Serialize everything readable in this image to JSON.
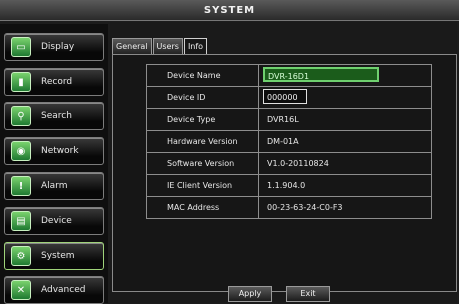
{
  "window": {
    "title": "SYSTEM"
  },
  "sidebar": {
    "items": [
      {
        "label": "Display",
        "icon": "display-icon",
        "active": false
      },
      {
        "label": "Record",
        "icon": "record-icon",
        "active": false
      },
      {
        "label": "Search",
        "icon": "search-icon",
        "active": false
      },
      {
        "label": "Network",
        "icon": "network-icon",
        "active": false
      },
      {
        "label": "Alarm",
        "icon": "alarm-icon",
        "active": false
      },
      {
        "label": "Device",
        "icon": "device-icon",
        "active": false
      },
      {
        "label": "System",
        "icon": "system-icon",
        "active": true
      },
      {
        "label": "Advanced",
        "icon": "advanced-icon",
        "active": false
      }
    ]
  },
  "tabs": [
    {
      "label": "General",
      "active": false
    },
    {
      "label": "Users",
      "active": false
    },
    {
      "label": "Info",
      "active": true
    }
  ],
  "info": {
    "rows": [
      {
        "label": "Device Name",
        "value": "DVR-16D1"
      },
      {
        "label": "Device ID",
        "value": "000000"
      },
      {
        "label": "Device Type",
        "value": "DVR16L"
      },
      {
        "label": "Hardware Version",
        "value": "DM-01A"
      },
      {
        "label": "Software Version",
        "value": "V1.0-20110824"
      },
      {
        "label": "IE Client Version",
        "value": "1.1.904.0"
      },
      {
        "label": "MAC Address",
        "value": "00-23-63-24-C0-F3"
      }
    ]
  },
  "footer": {
    "apply_label": "Apply",
    "exit_label": "Exit"
  },
  "colors": {
    "accent": "#6fd06f",
    "active_field_bg": "#1b5c1b"
  }
}
